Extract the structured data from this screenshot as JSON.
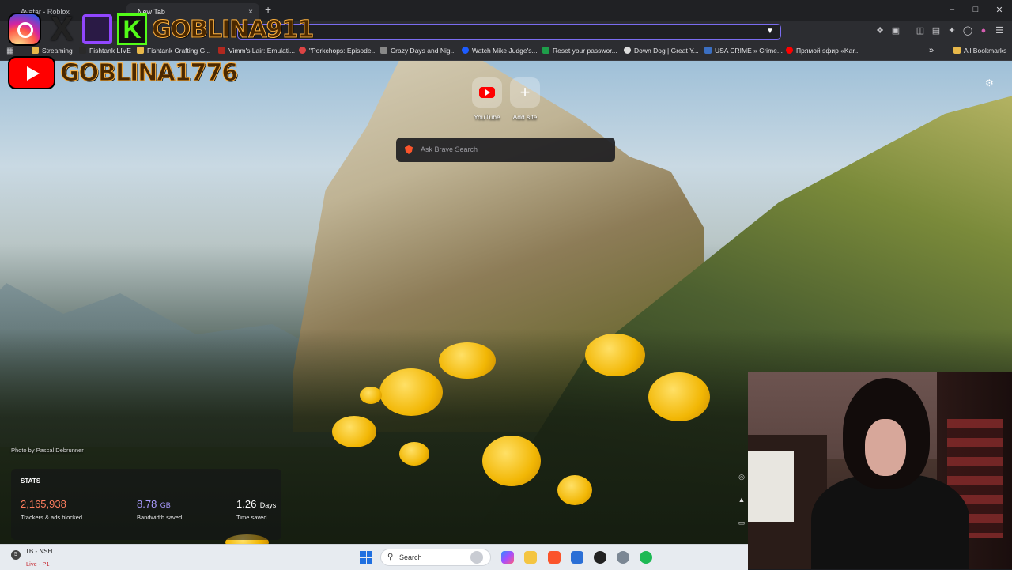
{
  "window": {
    "tabs": [
      {
        "label": "Avatar - Roblox",
        "active": false
      },
      {
        "label": "New Tab",
        "active": true
      }
    ],
    "new_tab_symbol": "+",
    "close_symbol": "×",
    "controls": {
      "minimize": "–",
      "maximize": "□",
      "close": "✕"
    }
  },
  "bookmarks": {
    "items": [
      {
        "label": "Streaming",
        "icon": "folder-icon",
        "color": "#e8b84a"
      },
      {
        "label": "Fishtank LIVE",
        "icon": "fishtank-icon",
        "color": "#2a2a2a"
      },
      {
        "label": "Fishtank Crafting G...",
        "icon": "folder-icon",
        "color": "#e8b84a"
      },
      {
        "label": "Vimm's Lair: Emulati...",
        "icon": "vimm-icon",
        "color": "#b1281f"
      },
      {
        "label": "\"Porkchops: Episode...",
        "icon": "site-icon",
        "color": "#d44"
      },
      {
        "label": "Crazy Days and Nig...",
        "icon": "site-icon",
        "color": "#888"
      },
      {
        "label": "Watch Mike Judge's...",
        "icon": "paramount-icon",
        "color": "#1d5cff"
      },
      {
        "label": "Reset your passwor...",
        "icon": "id-icon",
        "color": "#1e9e4a"
      },
      {
        "label": "Down Dog | Great Y...",
        "icon": "downdog-icon",
        "color": "#ddd"
      },
      {
        "label": "USA CRIME » Crime...",
        "icon": "site-icon",
        "color": "#3b6fc2"
      },
      {
        "label": "Прямой эфир «Kar...",
        "icon": "youtube-icon",
        "color": "#ff0000"
      }
    ],
    "overflow": "»",
    "all_bookmarks": "All Bookmarks"
  },
  "overlay": {
    "handle_top": "GOBLINA911",
    "handle_youtube": "GOBLINA1776"
  },
  "newtab": {
    "shortcuts": [
      {
        "label": "YouTube",
        "icon": "youtube-icon"
      },
      {
        "label": "Add site",
        "icon": "plus-icon"
      }
    ],
    "search_placeholder": "Ask Brave Search",
    "photo_credit": "Photo by Pascal Debrunner",
    "stats": {
      "title": "STATS",
      "items": [
        {
          "value": "2,165,938",
          "unit": "",
          "label": "Trackers & ads blocked",
          "color": "#ff7e5f"
        },
        {
          "value": "8.78",
          "unit": "GB",
          "label": "Bandwidth saved",
          "color": "#a99bff"
        },
        {
          "value": "1.26",
          "unit": "Days",
          "label": "Time saved",
          "color": "#ffffff"
        }
      ]
    }
  },
  "taskbar": {
    "weather_badge": "5",
    "weather_title": "TB - NSH",
    "weather_status": "Live - P1",
    "search_label": "Search"
  },
  "colors": {
    "accent": "#7a6cf0",
    "brave_orange": "#fb542b"
  }
}
